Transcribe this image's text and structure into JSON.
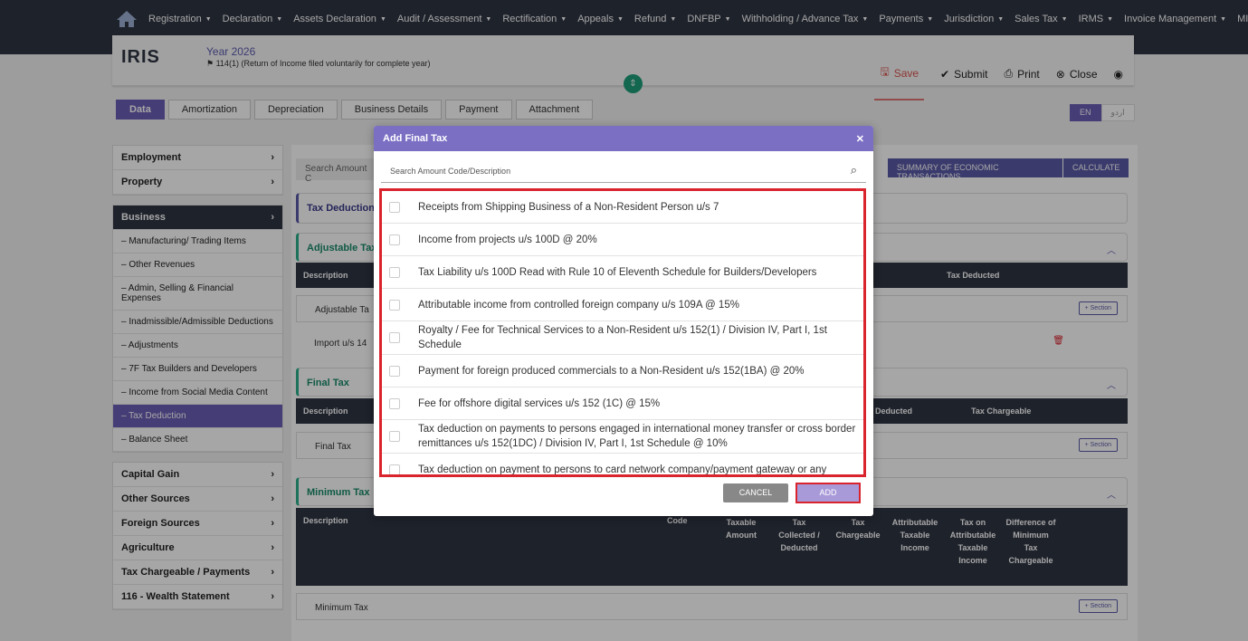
{
  "nav": {
    "items": [
      "Registration",
      "Declaration",
      "Assets Declaration",
      "Audit / Assessment",
      "Rectification",
      "Appeals",
      "Refund",
      "DNFBP",
      "Withholding / Advance Tax",
      "Payments",
      "Jurisdiction",
      "Sales Tax",
      "IRMS",
      "Invoice Management",
      "MIS"
    ]
  },
  "header": {
    "logo": "IRIS",
    "year": "Year 2026",
    "subtitle": "114(1) (Return of Income filed voluntarily for complete year)",
    "save": "Save",
    "submit": "Submit",
    "print": "Print",
    "close": "Close"
  },
  "tabs": [
    "Data",
    "Amortization",
    "Depreciation",
    "Business Details",
    "Payment",
    "Attachment"
  ],
  "lang": {
    "en": "EN",
    "ur": "اردو"
  },
  "sidebar": {
    "top": [
      "Employment",
      "Property"
    ],
    "business": "Business",
    "business_items": [
      "Manufacturing/ Trading Items",
      "Other Revenues",
      "Admin, Selling & Financial Expenses",
      "Inadmissible/Admissible Deductions",
      "Adjustments",
      "7F Tax Builders and Developers",
      "Income from Social Media Content",
      "Tax Deduction",
      "Balance Sheet"
    ],
    "bottom": [
      "Capital Gain",
      "Other Sources",
      "Foreign Sources",
      "Agriculture",
      "Tax Chargeable / Payments",
      "116 - Wealth Statement"
    ]
  },
  "main": {
    "search_placeholder": "Search Amount C",
    "btn_summary": "SUMMARY OF ECONOMIC TRANSACTIONS",
    "btn_calculate": "CALCULATE",
    "tax_deduction": "Tax Deduction",
    "adjustable_tax": "Adjustable Tax",
    "adj_desc": "Description",
    "adj_tax_deducted": "Tax Deducted",
    "adj_row1": "Adjustable Ta",
    "adj_row2": "Import u/s 14",
    "section_btn": "+ Section",
    "final_tax": "Final Tax",
    "final_desc": "Description",
    "final_deducted": "Deducted",
    "final_chargeable": "Tax Chargeable",
    "final_row": "Final Tax",
    "min_tax": "Minimum Tax",
    "min_cols": [
      "Description",
      "Code",
      "Taxable Amount",
      "Tax Collected / Deducted",
      "Tax Chargeable",
      "Attributable Taxable Income",
      "Tax on Attributable Taxable Income",
      "Difference of Minimum Tax Chargeable"
    ],
    "min_row": "Minimum Tax"
  },
  "modal": {
    "title": "Add Final Tax",
    "search_placeholder": "Search Amount Code/Description",
    "items": [
      "Receipts from Shipping Business of a Non-Resident Person u/s 7",
      "Income from projects u/s 100D @ 20%",
      "Tax Liability u/s 100D Read with Rule 10 of Eleventh Schedule for Builders/Developers",
      "Attributable income from controlled foreign company u/s 109A @ 15%",
      "Royalty / Fee for Technical Services to a Non-Resident u/s 152(1) / Division IV, Part I, 1st Schedule",
      "Payment for foreign produced commercials to a Non-Resident u/s 152(1BA) @ 20%",
      "Fee for offshore digital services u/s 152 (1C) @ 15%",
      "Tax deduction on payments to persons engaged in international money transfer or cross border remittances u/s 152(1DC) / Division IV, Part I, 1st Schedule @ 10%",
      "Tax deduction on payment to persons to card network company/payment gateway or any"
    ],
    "cancel": "CANCEL",
    "add": "ADD"
  }
}
